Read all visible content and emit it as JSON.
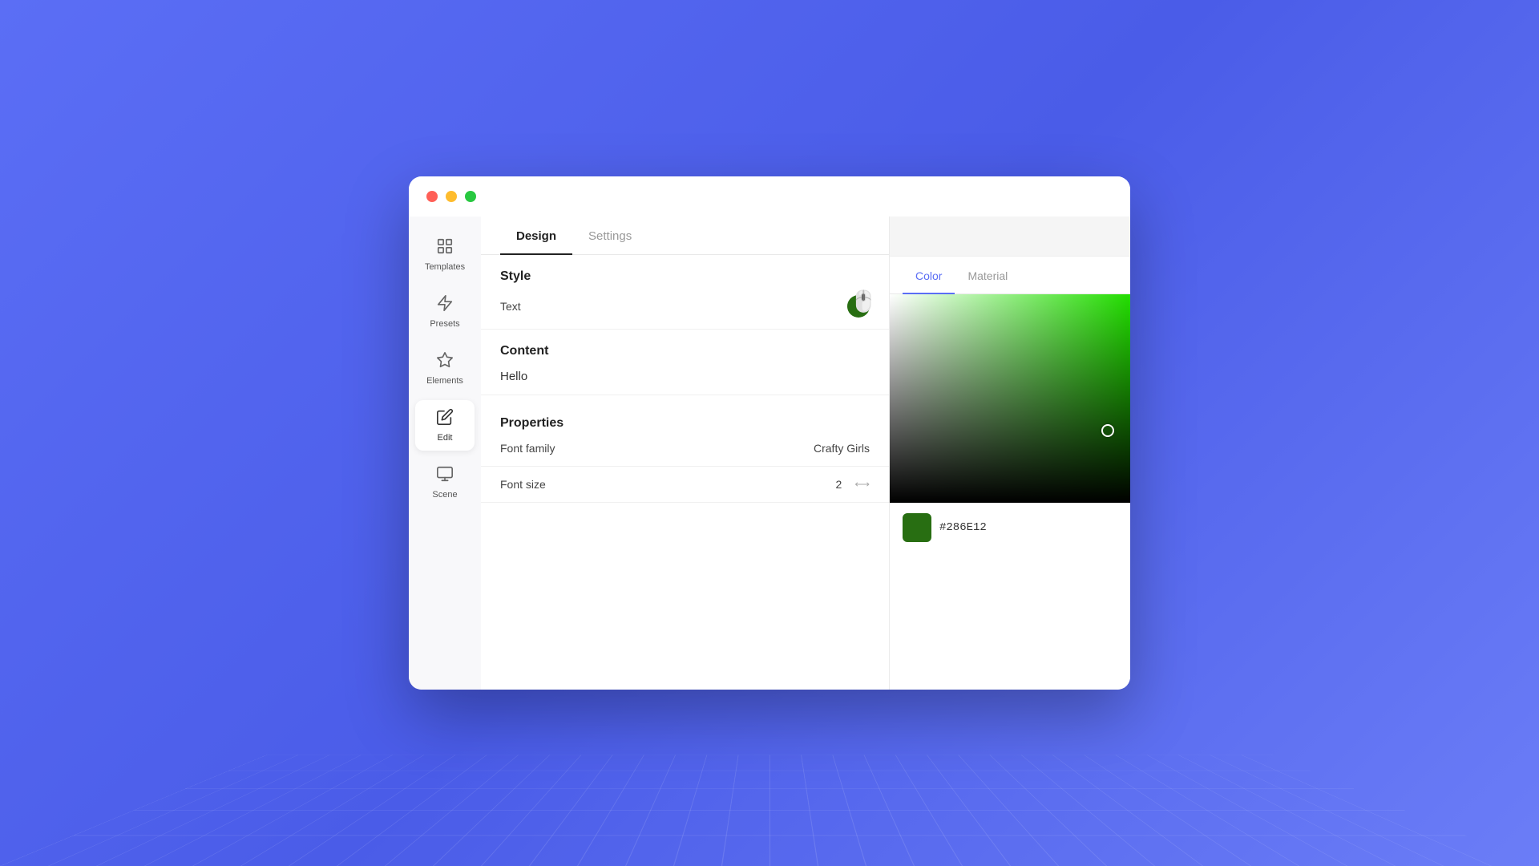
{
  "window": {
    "traffic_lights": {
      "close": "close",
      "minimize": "minimize",
      "maximize": "maximize"
    }
  },
  "sidebar": {
    "items": [
      {
        "id": "templates",
        "label": "Templates",
        "active": false
      },
      {
        "id": "presets",
        "label": "Presets",
        "active": false
      },
      {
        "id": "elements",
        "label": "Elements",
        "active": false
      },
      {
        "id": "edit",
        "label": "Edit",
        "active": true
      },
      {
        "id": "scene",
        "label": "Scene",
        "active": false
      }
    ]
  },
  "design_panel": {
    "tabs": [
      {
        "id": "design",
        "label": "Design",
        "active": true
      },
      {
        "id": "settings",
        "label": "Settings",
        "active": false
      }
    ],
    "style_section": {
      "title": "Style",
      "field_label": "Text"
    },
    "content_section": {
      "title": "Content",
      "value": "Hello"
    },
    "properties_section": {
      "title": "Properties",
      "font_family_label": "Font family",
      "font_family_value": "Crafty Girls",
      "font_size_label": "Font size",
      "font_size_value": "2"
    }
  },
  "color_panel": {
    "tabs": [
      {
        "id": "color",
        "label": "Color",
        "active": true
      },
      {
        "id": "material",
        "label": "Material",
        "active": false
      }
    ],
    "hex_value": "#286E12",
    "picker_color": "#286E12"
  }
}
